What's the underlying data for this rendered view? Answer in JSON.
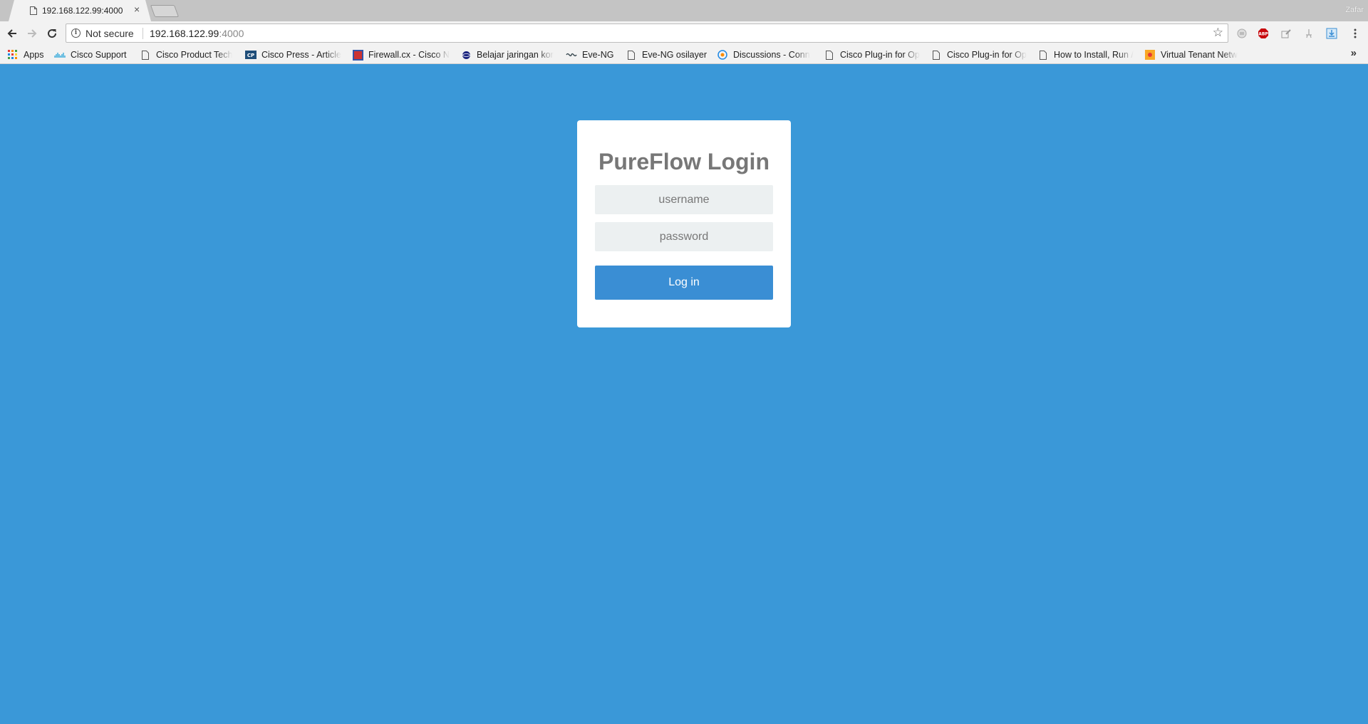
{
  "browser": {
    "tab": {
      "title": "192.168.122.99:4000",
      "close_glyph": "×"
    },
    "profile_name": "Zafar",
    "omnibox": {
      "security_label": "Not secure",
      "url_host": "192.168.122.99",
      "url_port": ":4000"
    },
    "bookmarks": [
      {
        "label": "Apps",
        "icon": "apps-grid-icon"
      },
      {
        "label": "Cisco Support",
        "icon": "cisco-logo-icon"
      },
      {
        "label": "Cisco Product Tech",
        "icon": "page-icon"
      },
      {
        "label": "Cisco Press - Article",
        "icon": "cisco-press-icon"
      },
      {
        "label": "Firewall.cx - Cisco N",
        "icon": "firewall-cx-icon"
      },
      {
        "label": "Belajar jaringan kor",
        "icon": "globe-icon"
      },
      {
        "label": "Eve-NG",
        "icon": "eve-ng-icon"
      },
      {
        "label": "Eve-NG osilayer",
        "icon": "page-icon"
      },
      {
        "label": "Discussions - Conn",
        "icon": "discussions-icon"
      },
      {
        "label": "Cisco Plug-in for Op",
        "icon": "page-icon"
      },
      {
        "label": "Cisco Plug-in for Op",
        "icon": "page-icon"
      },
      {
        "label": "How to Install, Run /",
        "icon": "page-icon"
      },
      {
        "label": "Virtual Tenant Netw",
        "icon": "orange-square-icon"
      }
    ],
    "overflow_glyph": "»"
  },
  "login": {
    "title": "PureFlow Login",
    "username_placeholder": "username",
    "password_placeholder": "password",
    "button_label": "Log in"
  },
  "colors": {
    "page_background": "#3a98d8",
    "button_background": "#3a8ed4",
    "input_background": "#ecf0f1",
    "title_text": "#777777"
  }
}
